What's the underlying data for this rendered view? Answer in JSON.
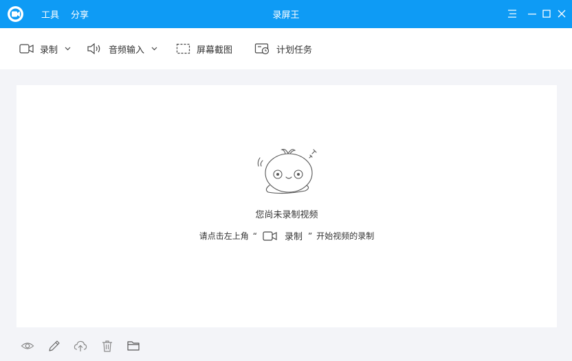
{
  "app": {
    "title": "录屏王"
  },
  "menu": {
    "tools_label": "工具",
    "share_label": "分享"
  },
  "toolbar": {
    "record_label": "录制",
    "audio_input_label": "音频输入",
    "screenshot_label": "屏幕截图",
    "scheduled_task_label": "计划任务"
  },
  "empty_state": {
    "title": "您尚未录制视频",
    "hint_before": "请点击左上角",
    "quote_open": "“",
    "record_label": "录制",
    "quote_close": "”",
    "hint_after": "开始视频的录制"
  },
  "bottom_toolbar": {
    "icons": [
      "eye-icon",
      "pencil-icon",
      "cloud-upload-icon",
      "trash-icon",
      "folder-icon"
    ]
  },
  "colors": {
    "titlebar": "#0e9bf5",
    "background": "#f3f4f8",
    "panel": "#ffffff",
    "icon_gray": "#888888"
  }
}
